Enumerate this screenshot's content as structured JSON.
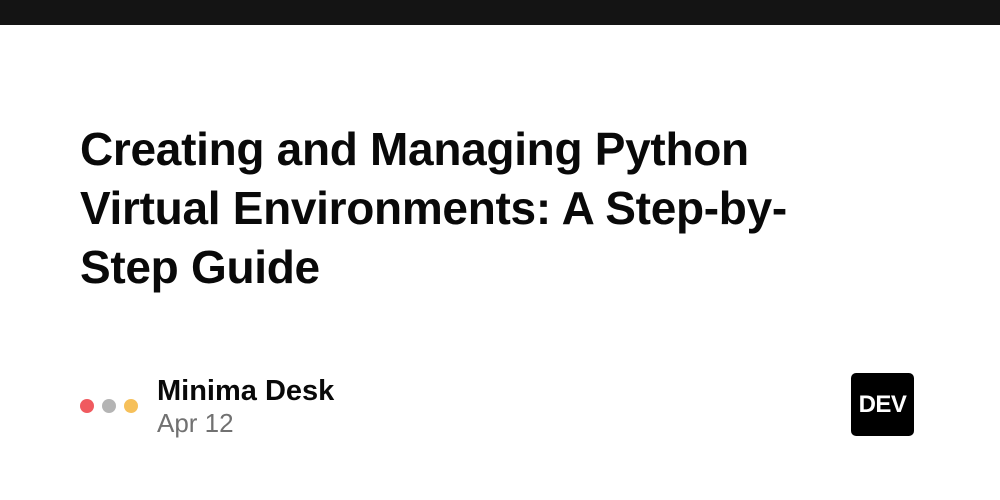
{
  "post": {
    "title": "Creating and Managing Python Virtual Environments: A Step-by-Step Guide",
    "author": "Minima Desk",
    "date": "Apr 12"
  },
  "brand": {
    "logo_text": "DEV"
  },
  "avatar_dots": [
    {
      "icon": "red-dot-icon",
      "color": "#f05a5f"
    },
    {
      "icon": "gray-dot-icon",
      "color": "#b4b4b4"
    },
    {
      "icon": "yellow-dot-icon",
      "color": "#f6c05a"
    }
  ],
  "colors": {
    "top_bar": "#141414",
    "background": "#ffffff",
    "title": "#090909",
    "date": "#717171",
    "logo_bg": "#000000"
  }
}
